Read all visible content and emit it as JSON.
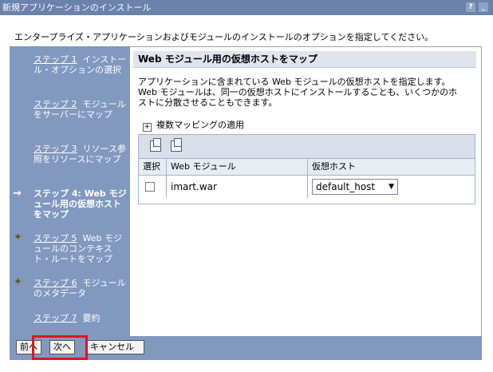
{
  "window": {
    "title": "新規アプリケーションのインストール",
    "help_label": "?",
    "minimize_label": "_"
  },
  "instruction": "エンタープライズ・アプリケーションおよびモジュールのインストールのオプションを指定してください。",
  "nav": {
    "steps": [
      {
        "link": "ステップ 1",
        "text": "インストール・オプションの選択"
      },
      {
        "link": "ステップ 2",
        "text": "モジュールをサーバーにマップ"
      },
      {
        "link": "ステップ 3",
        "text": "リソース参照をリソースにマップ"
      },
      {
        "current": "ステップ 4: Web モジュール用の仮想ホストをマップ"
      },
      {
        "link": "ステップ 5",
        "text": "Web モジュールのコンテキスト・ルートをマップ"
      },
      {
        "link": "ステップ 6",
        "text": "モジュールのメタデータ"
      },
      {
        "link": "ステップ 7",
        "text": "要約"
      }
    ],
    "arrow": "→",
    "diamond": "✦"
  },
  "section": {
    "title": "Web モジュール用の仮想ホストをマップ",
    "description": "アプリケーションに含まれている Web モジュールの仮想ホストを指定します。Web モジュールは、同一の仮想ホストにインストールすることも、いくつかのホストに分散させることもできます。",
    "expander_label": "複数マッピングの適用",
    "expander_symbol": "+"
  },
  "table": {
    "toolbar_icons": [
      "select-all-icon",
      "deselect-all-icon"
    ],
    "headers": [
      "選択",
      "Web モジュール",
      "仮想ホスト"
    ],
    "rows": [
      {
        "module": "imart.war",
        "host": "default_host"
      }
    ]
  },
  "buttons": {
    "previous": "前へ",
    "next": "次へ",
    "cancel": "キャンセル"
  },
  "colors": {
    "titlebar": "#6b82ab",
    "nav_bg": "#8198bf",
    "highlight": "#e0141d"
  }
}
